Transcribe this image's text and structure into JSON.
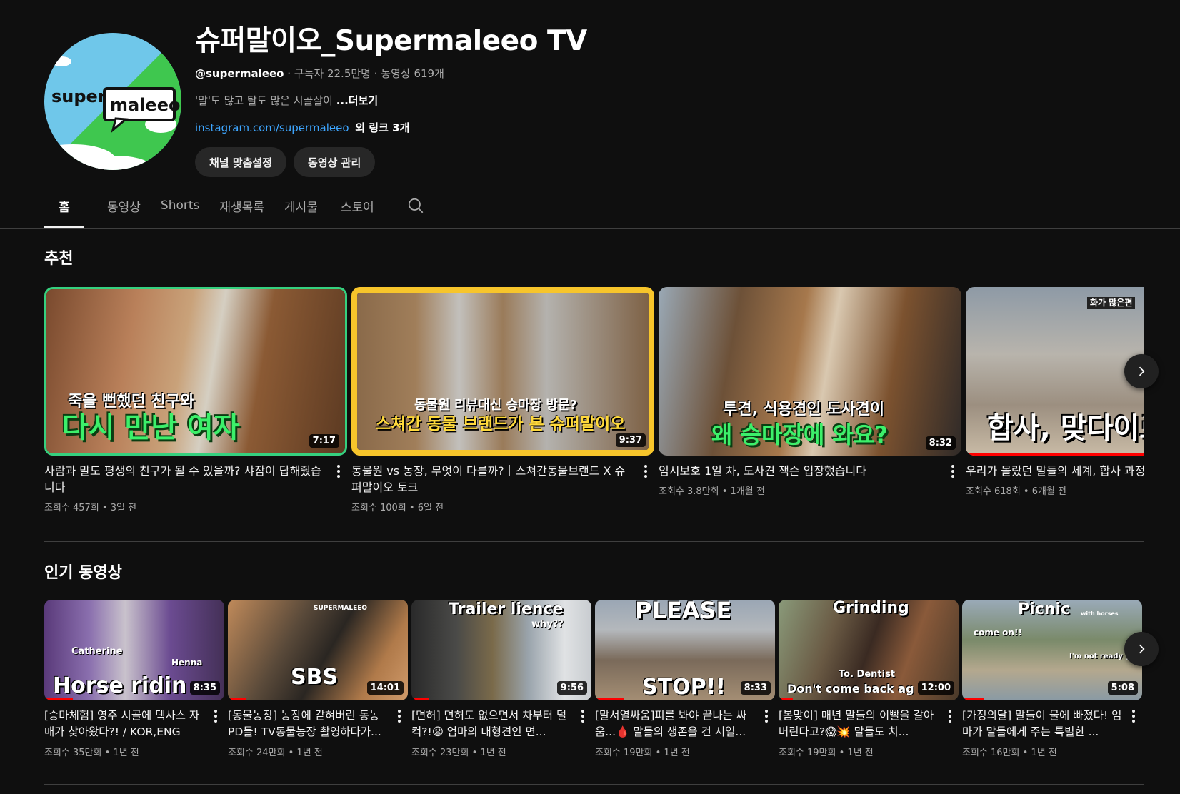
{
  "channel": {
    "title": "슈퍼말이오_Supermaleeo TV",
    "handle": "@supermaleeo",
    "subscribers": "구독자 22.5만명",
    "video_count": "동영상 619개",
    "description": "'말'도 많고 탈도 많은 시골살이 ",
    "more_label": "...더보기",
    "link": "instagram.com/supermaleeo",
    "more_links": "외 링크 3개",
    "avatar_text_a": "super",
    "avatar_text_b": "maleeo",
    "customize_label": "채널 맞춤설정",
    "manage_label": "동영상 관리"
  },
  "tabs": [
    "홈",
    "동영상",
    "Shorts",
    "재생목록",
    "게시물",
    "스토어"
  ],
  "recommended": {
    "title": "추천",
    "videos": [
      {
        "title": "사람과 말도 평생의 친구가 될 수 있을까? 샤잠이 답해줬습니다",
        "views": "조회수 457회",
        "age": "3일 전",
        "duration": "7:17",
        "overlay_1": "죽을 뻔했던 친구와",
        "overlay_2": "다시 만난 여자"
      },
      {
        "title": "동물원 vs 농장, 무엇이 다를까?｜스쳐간동물브랜드 X 슈퍼말이오 토크",
        "views": "조회수 100회",
        "age": "6일 전",
        "duration": "9:37",
        "overlay_1": "동물원 리뷰대신 승마장 방문?",
        "overlay_2": "스쳐간 동물 브랜드가 본 슈퍼말이오"
      },
      {
        "title": "임시보호 1일 차, 도사견 잭슨 입장했습니다",
        "views": "조회수 3.8만회",
        "age": "1개월 전",
        "duration": "8:32",
        "overlay_1": "투견, 식용견인 도사견이",
        "overlay_2": "왜 승마장에 와요?"
      },
      {
        "title": "우리가 몰랐던 말들의 세계, 합사 과정 고?",
        "views": "조회수 618회",
        "age": "6개월 전",
        "duration": "",
        "overlay_1": "화가 많은편",
        "overlay_2": "합사, 맞다이로"
      }
    ]
  },
  "popular": {
    "title": "인기 동영상",
    "videos": [
      {
        "title": "[승마체험] 영주 시골에 텍사스 자매가 찾아왔다?! / KOR,ENG",
        "views": "조회수 35만회",
        "age": "1년 전",
        "duration": "8:35",
        "overlay_1": "Catherine",
        "overlay_2": "Henna",
        "overlay_3": "Horse ridin"
      },
      {
        "title": "[동물농장] 농장에 갇혀버린 동농 PD들! TV동물농장 촬영하다가...",
        "views": "조회수 24만회",
        "age": "1년 전",
        "duration": "14:01",
        "overlay_1": "SUPERMALEEO",
        "overlay_2": "SBS",
        "overlay_3": ""
      },
      {
        "title": "[면허] 면허도 없으면서 차부터 덜컥?!😫 엄마의 대형견인 면...",
        "views": "조회수 23만회",
        "age": "1년 전",
        "duration": "9:56",
        "overlay_1": "Trailer lience",
        "overlay_2": "why??",
        "overlay_3": ""
      },
      {
        "title": "[말서열싸움]피를 봐야 끝나는 싸움...🩸 말들의 생존을 건 서열...",
        "views": "조회수 19만회",
        "age": "1년 전",
        "duration": "8:33",
        "overlay_1": "PLEASE",
        "overlay_2": "STOP!!",
        "overlay_3": ""
      },
      {
        "title": "[봄맞이] 매년 말들의 이빨을 갈아버린다고?😱💥 말들도 치...",
        "views": "조회수 19만회",
        "age": "1년 전",
        "duration": "12:00",
        "overlay_1": "Grinding",
        "overlay_2": "To. Dentist",
        "overlay_3": "Don't come back ag"
      },
      {
        "title": "[가정의달] 말들이 물에 빠졌다! 엄마가 말들에게 주는 특별한 ...",
        "views": "조회수 16만회",
        "age": "1년 전",
        "duration": "5:08",
        "overlay_1": "Picnic",
        "overlay_2": "with horses",
        "overlay_3": "come on!!",
        "overlay_4": "I'm not ready yet.."
      }
    ]
  },
  "colors": {
    "background": "#0f0f0f",
    "link": "#3ea6ff",
    "pill": "#272727",
    "progress": "#ff0000"
  }
}
